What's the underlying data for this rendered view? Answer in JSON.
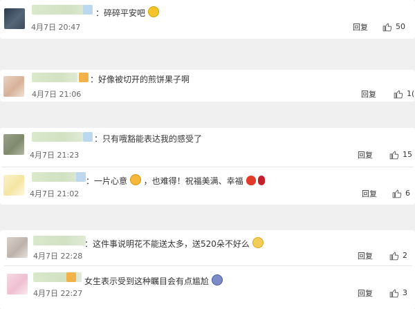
{
  "comments": [
    {
      "text": "：碎碎平安吧",
      "time": "4月7日 20:47",
      "reply": "回复",
      "likes": "50"
    },
    {
      "text": "：好像被切开的煎饼果子啊",
      "time": "4月7日 21:06",
      "reply": "回复",
      "likes": "1("
    },
    {
      "text": "：只有哦豁能表达我的感受了",
      "time": "4月7日 21:23",
      "reply": "回复",
      "likes": "15"
    },
    {
      "text": "：一片心意",
      "text2": "，也难得！祝福美满、幸福",
      "time": "4月7日 21:02",
      "reply": "回复",
      "likes": "6"
    },
    {
      "text": "：这件事说明花不能送太多，送520朵不好么",
      "time": "4月7日 22:28",
      "reply": "回复",
      "likes": "2"
    },
    {
      "text": "女生表示受到这种瞩目会有点尴尬",
      "time": "4月7日 22:27",
      "reply": "回复",
      "likes": "3"
    }
  ],
  "icons": {
    "like": "thumbs-up-icon"
  },
  "colors": {
    "background": "#f0f0f0",
    "card": "#ffffff"
  }
}
